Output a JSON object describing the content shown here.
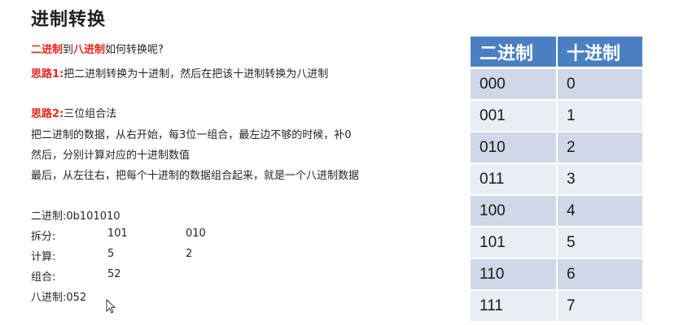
{
  "title": "进制转换",
  "intro": {
    "a": "二进制",
    "b": "到",
    "c": "八进制",
    "d": "如何转换呢?"
  },
  "idea1": {
    "label": "思路1:",
    "text": "把二进制转换为十进制，然后在把该十进制转换为八进制"
  },
  "idea2": {
    "label": "思路2:",
    "text": "三位组合法"
  },
  "steps": [
    "把二进制的数据，从右开始，每3位一组合，最左边不够的时候，补0",
    "然后，分别计算对应的十进制数值",
    "最后，从左往右，把每个十进制的数据组合起来，就是一个八进制数据"
  ],
  "example": {
    "binary_label": "二进制:",
    "binary_value": "0b101010",
    "split_label": "拆分:",
    "split_a": "101",
    "split_b": "010",
    "calc_label": "计算:",
    "calc_a": "5",
    "calc_b": "2",
    "combine_label": "组合:",
    "combine_value": "52",
    "octal_label": "八进制:",
    "octal_value": "052"
  },
  "table": {
    "headers": [
      "二进制",
      "十进制"
    ],
    "rows": [
      [
        "000",
        "0"
      ],
      [
        "001",
        "1"
      ],
      [
        "010",
        "2"
      ],
      [
        "011",
        "3"
      ],
      [
        "100",
        "4"
      ],
      [
        "101",
        "5"
      ],
      [
        "110",
        "6"
      ],
      [
        "111",
        "7"
      ]
    ]
  },
  "colors": {
    "accent_red": "#e8251c",
    "header_blue": "#4a7fc2",
    "row_dark": "#d0d8e8",
    "row_light": "#e9edf4"
  }
}
